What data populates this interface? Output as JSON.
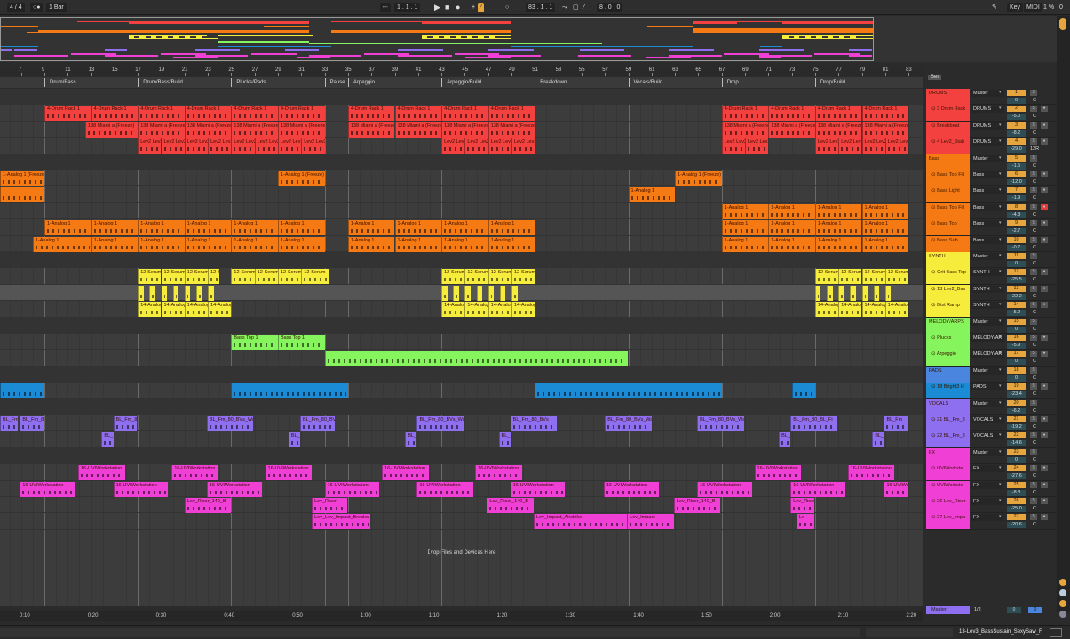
{
  "topbar": {
    "signature": "4 / 4",
    "quantize": "1 Bar",
    "position": "1 . 1 . 1",
    "loop_start": "83 . 1 . 1",
    "loop_length": "8 . 0 . 0",
    "key": "Key",
    "midi": "MIDI",
    "cpu": "1 %",
    "disk": "0"
  },
  "ruler_bars": [
    7,
    9,
    11,
    13,
    15,
    17,
    19,
    21,
    23,
    25,
    27,
    29,
    31,
    33,
    35,
    37,
    39,
    41,
    43,
    45,
    47,
    49,
    51,
    53,
    55,
    57,
    59,
    61,
    63,
    65,
    67,
    69,
    71,
    73,
    75,
    77,
    79,
    81,
    83
  ],
  "locators": [
    {
      "bar": 9,
      "label": "Drum/Bass"
    },
    {
      "bar": 17,
      "label": "Drum/Bass/Build"
    },
    {
      "bar": 25,
      "label": "Plucks/Pads"
    },
    {
      "bar": 33,
      "label": "Pause"
    },
    {
      "bar": 35,
      "label": "Arpeggio"
    },
    {
      "bar": 43,
      "label": "Arpeggio/Build"
    },
    {
      "bar": 51,
      "label": "Breakdown"
    },
    {
      "bar": 59,
      "label": "Vocals/Build"
    },
    {
      "bar": 67,
      "label": "Drop"
    },
    {
      "bar": 75,
      "label": "Drop/Build"
    }
  ],
  "time_ticks": [
    "0:10",
    "0:20",
    "0:30",
    "0:40",
    "0:50",
    "1:00",
    "1:10",
    "1:20",
    "1:30",
    "1:40",
    "1:50",
    "2:00",
    "2:10",
    "2:20"
  ],
  "drop_hint": "Drop Files and Devices Here",
  "set_label": "Set",
  "master": {
    "name": "Master",
    "route": "1/2",
    "vol": "0",
    "pan": "0"
  },
  "status_text": "13-Lev3_BassSustain_SexySaw_F",
  "colors": {
    "red": "#f2413f",
    "orange": "#f57a13",
    "yellow": "#f5ec3c",
    "green": "#86f45c",
    "blue": "#1b8bd6",
    "purple": "#8e6ff0",
    "pink": "#f03fd4",
    "headerblue": "#4a86e0"
  },
  "tracks": [
    {
      "name": "DRUMS",
      "color": "red",
      "route": "Master",
      "num": "1",
      "vol": "0",
      "pan": "C",
      "group": true,
      "clips": []
    },
    {
      "name": "3 Drum Rack",
      "color": "red",
      "route": "DRUMS",
      "num": "2",
      "vol": "-5.0",
      "pan": "C",
      "clips": [
        [
          9,
          4,
          "4-Drum Rack 1"
        ],
        [
          13,
          4,
          "4-Drum Rack 1"
        ],
        [
          17,
          4,
          "4-Drum Rack 1"
        ],
        [
          21,
          4,
          "4-Drum Rack 1"
        ],
        [
          25,
          4,
          "4-Drum Rack 1"
        ],
        [
          29,
          4,
          "4-Drum Rack 1"
        ],
        [
          35,
          4,
          "4-Drum Rack 1"
        ],
        [
          39,
          4,
          "4-Drum Rack 1"
        ],
        [
          43,
          4,
          "4-Drum Rack 1"
        ],
        [
          47,
          4,
          "4-Drum Rack 1"
        ],
        [
          67,
          4,
          "4-Drum Rack 1"
        ],
        [
          71,
          4,
          "4-Drum Rack 1"
        ],
        [
          75,
          4,
          "4-Drum Rack 1"
        ],
        [
          79,
          4,
          "4-Drum Rack 1"
        ]
      ]
    },
    {
      "name": "Breakbeat",
      "color": "red",
      "route": "DRUMS",
      "num": "3",
      "vol": "-8.2",
      "pan": "C",
      "clips": [
        [
          12.5,
          4.5,
          "138 Miami a (Freeze)"
        ],
        [
          17,
          4,
          "138 Miami a (Freeze)"
        ],
        [
          21,
          4,
          "138 Miami a (Freeze)"
        ],
        [
          25,
          4,
          "138 Miami a (Freeze)"
        ],
        [
          29,
          4,
          "138 Miami a (Freeze)"
        ],
        [
          35,
          4,
          "138 Miami a (Freeze)"
        ],
        [
          39,
          4,
          "138 Miami a (Freeze)"
        ],
        [
          43,
          4,
          "138 Miami a (Freeze)"
        ],
        [
          47,
          4,
          "138 Miami a (Freeze)"
        ],
        [
          67,
          4,
          "138 Miami a (Freeze)"
        ],
        [
          71,
          4,
          "138 Miami a (Freeze)"
        ],
        [
          75,
          4,
          "138 Miami a (Freeze)"
        ],
        [
          79,
          4,
          "138 Miami a (Freeze)"
        ]
      ]
    },
    {
      "name": "4 Lev2_Stab",
      "color": "red",
      "route": "DRUMS",
      "num": "4",
      "vol": "-29.0",
      "pan": "12R",
      "clips": [
        [
          17,
          2,
          "Lev2 Lev2"
        ],
        [
          19,
          2,
          "Lev2 Lev2"
        ],
        [
          21,
          2,
          "Lev2 Lev2"
        ],
        [
          23,
          2,
          "Lev2 Lev2"
        ],
        [
          25,
          2,
          "Lev2 Lev2"
        ],
        [
          27,
          2,
          "Lev2 Lev2"
        ],
        [
          29,
          2,
          "Lev2 Lev2"
        ],
        [
          31,
          2,
          "Lev2 Lev2"
        ],
        [
          43,
          2,
          "Lev2 Lev2"
        ],
        [
          45,
          2,
          "Lev2 Lev2"
        ],
        [
          47,
          2,
          "Lev2 Lev2"
        ],
        [
          49,
          2,
          "Lev2 Lev2"
        ],
        [
          67,
          2,
          "Lev2 Lev2"
        ],
        [
          69,
          2,
          "Lev2 Lev2"
        ],
        [
          75,
          2,
          "Lev2 Lev2"
        ],
        [
          77,
          2,
          "Lev2 Lev2"
        ],
        [
          79,
          2,
          "Lev2 Lev2"
        ],
        [
          81,
          2,
          "Lev2 Lev2"
        ]
      ]
    },
    {
      "name": "Bass",
      "color": "orange",
      "route": "Master",
      "num": "5",
      "vol": "-1.5",
      "pan": "C",
      "group": true,
      "clips": []
    },
    {
      "name": "Bass Top Fill",
      "color": "orange",
      "route": "Bass",
      "num": "6",
      "vol": "-12.0",
      "pan": "C",
      "clips": [
        [
          5.2,
          3.8,
          "1-Analog 1 (Freeze)"
        ],
        [
          29,
          4,
          "1-Analog 1 (Freeze)"
        ],
        [
          63,
          4,
          "1-Analog 1 (Freeze)"
        ]
      ]
    },
    {
      "name": "Bass Light",
      "color": "orange",
      "route": "Bass",
      "num": "7",
      "vol": "-1.9",
      "pan": "C",
      "clips": [
        [
          5.2,
          3.8,
          ""
        ],
        [
          59,
          4,
          "1-Analog 1"
        ]
      ]
    },
    {
      "name": "Bass Top Fill",
      "color": "orange",
      "route": "Bass",
      "num": "8",
      "vol": "-4.8",
      "pan": "C",
      "armed": true,
      "clips": [
        [
          67,
          4,
          "1-Analog 1"
        ],
        [
          71,
          4,
          "1-Analog 1"
        ],
        [
          75,
          4,
          "1-Analog 1"
        ],
        [
          79,
          4,
          "1-Analog 1"
        ]
      ]
    },
    {
      "name": "Bass Top",
      "color": "orange",
      "route": "Bass",
      "num": "9",
      "vol": "-2.7",
      "pan": "C",
      "clips": [
        [
          9,
          4,
          "1-Analog 1"
        ],
        [
          13,
          4,
          "1-Analog 1"
        ],
        [
          17,
          4,
          "1-Analog 1"
        ],
        [
          21,
          4,
          "1-Analog 1"
        ],
        [
          25,
          4,
          "1-Analog 1"
        ],
        [
          29,
          4,
          "1-Analog 1"
        ],
        [
          35,
          4,
          "1-Analog 1"
        ],
        [
          39,
          4,
          "1-Analog 1"
        ],
        [
          43,
          4,
          "1-Analog 1"
        ],
        [
          47,
          4,
          "1-Analog 1"
        ],
        [
          67,
          4,
          "1-Analog 1"
        ],
        [
          71,
          4,
          "1-Analog 1"
        ],
        [
          75,
          4,
          "1-Analog 1"
        ],
        [
          79,
          4,
          "1-Analog 1"
        ]
      ]
    },
    {
      "name": "Bass Sub",
      "color": "orange",
      "route": "Bass",
      "num": "10",
      "vol": "-0.7",
      "pan": "C",
      "clips": [
        [
          8,
          5,
          "1-Analog 1"
        ],
        [
          13,
          4,
          "1-Analog 1"
        ],
        [
          17,
          4,
          "1-Analog 1"
        ],
        [
          21,
          4,
          "1-Analog 1"
        ],
        [
          25,
          4,
          "1-Analog 1"
        ],
        [
          29,
          4,
          "1-Analog 1"
        ],
        [
          35,
          4,
          "1-Analog 1"
        ],
        [
          39,
          4,
          "1-Analog 1"
        ],
        [
          43,
          4,
          "1-Analog 1"
        ],
        [
          47,
          4,
          "1-Analog 1"
        ],
        [
          67,
          4,
          "1-Analog 1"
        ],
        [
          71,
          4,
          "1-Analog 1"
        ],
        [
          75,
          4,
          "1-Analog 1"
        ],
        [
          79,
          4,
          "1-Analog 1"
        ]
      ]
    },
    {
      "name": "SYNTH",
      "color": "yellow",
      "route": "Master",
      "num": "11",
      "vol": "0",
      "pan": "C",
      "group": true,
      "clips": []
    },
    {
      "name": "Grit Bass Top",
      "color": "yellow",
      "route": "SYNTH",
      "num": "12",
      "vol": "-25.5",
      "pan": "C",
      "clips": [
        [
          17,
          2,
          "12-Serum"
        ],
        [
          19,
          2,
          "12-Serum"
        ],
        [
          21,
          2,
          "12-Serum"
        ],
        [
          23,
          1,
          "12-S"
        ],
        [
          25,
          2,
          "12-Serum"
        ],
        [
          27,
          2,
          "12-Serum"
        ],
        [
          29,
          2,
          "12-Serum"
        ],
        [
          31,
          2.3,
          "12-Serum"
        ],
        [
          43,
          2,
          "12-Serum"
        ],
        [
          45,
          2,
          "12-Serum"
        ],
        [
          47,
          2,
          "12-Serum"
        ],
        [
          49,
          2,
          "12-Serum"
        ],
        [
          75,
          2,
          "12-Serum"
        ],
        [
          77,
          2,
          "12-Serum"
        ],
        [
          79,
          2,
          "12-Serum"
        ],
        [
          81,
          2,
          "12-Serum"
        ]
      ]
    },
    {
      "name": "13 Lev2_Bas",
      "color": "yellow",
      "route": "SYNTH",
      "num": "13",
      "vol": "-22.2",
      "pan": "C",
      "selected": true,
      "clips": [
        [
          17,
          0.5,
          ""
        ],
        [
          18,
          0.5,
          ""
        ],
        [
          19,
          0.5,
          ""
        ],
        [
          20,
          0.5,
          ""
        ],
        [
          21,
          0.5,
          ""
        ],
        [
          22,
          0.5,
          ""
        ],
        [
          23,
          0.5,
          ""
        ],
        [
          43,
          0.5,
          ""
        ],
        [
          44,
          0.5,
          ""
        ],
        [
          45,
          0.5,
          ""
        ],
        [
          46,
          0.5,
          ""
        ],
        [
          47,
          0.5,
          ""
        ],
        [
          48,
          0.5,
          ""
        ],
        [
          49,
          0.5,
          ""
        ],
        [
          75,
          0.5,
          ""
        ],
        [
          76,
          0.5,
          ""
        ],
        [
          77,
          0.5,
          ""
        ],
        [
          78,
          0.5,
          ""
        ],
        [
          79,
          0.5,
          ""
        ],
        [
          80,
          0.5,
          ""
        ],
        [
          81,
          0.5,
          ""
        ]
      ]
    },
    {
      "name": "Dist Ramp",
      "color": "yellow",
      "route": "SYNTH",
      "num": "14",
      "vol": "-5.2",
      "pan": "C",
      "clips": [
        [
          17,
          2,
          "14-Analog"
        ],
        [
          19,
          2,
          "14-Analog"
        ],
        [
          21,
          2,
          "14-Analog"
        ],
        [
          23,
          2,
          "14-Analog"
        ],
        [
          43,
          2,
          "14-Analog"
        ],
        [
          45,
          2,
          "14-Analog"
        ],
        [
          47,
          2,
          "14-Analog"
        ],
        [
          49,
          2,
          "14-Analog"
        ],
        [
          75,
          2,
          "14-Analog"
        ],
        [
          77,
          2,
          "14-Analog"
        ],
        [
          79,
          2,
          "14-Analog"
        ],
        [
          81,
          2,
          "14-Analog"
        ]
      ]
    },
    {
      "name": "MELODY/ARPS",
      "color": "green",
      "route": "Master",
      "num": "15",
      "vol": "0",
      "pan": "C",
      "group": true,
      "clips": []
    },
    {
      "name": "Plucks",
      "color": "green",
      "route": "MELODY/AR",
      "num": "16",
      "vol": "-5.9",
      "pan": "C",
      "clips": [
        [
          25,
          4,
          "Bass Top 1"
        ],
        [
          29,
          4,
          "Bass Top 1"
        ]
      ]
    },
    {
      "name": "Arpeggio",
      "color": "green",
      "route": "MELODY/AR",
      "num": "17",
      "vol": "0",
      "pan": "C",
      "clips": [
        [
          33,
          26,
          ""
        ]
      ]
    },
    {
      "name": "PADS",
      "color": "headerblue",
      "route": "Master",
      "num": "18",
      "vol": "0",
      "pan": "C",
      "group": true,
      "clips": []
    },
    {
      "name": "18 Bright3 H",
      "color": "blue",
      "route": "PADS",
      "num": "19",
      "vol": "-23.4",
      "pan": "C",
      "clips": [
        [
          5.2,
          3.8,
          ""
        ],
        [
          25,
          10,
          ""
        ],
        [
          51,
          16,
          ""
        ],
        [
          73,
          2,
          ""
        ]
      ]
    },
    {
      "name": "VOCALS",
      "color": "purple",
      "route": "Master",
      "num": "20",
      "vol": "-6.2",
      "pan": "C",
      "group": true,
      "clips": []
    },
    {
      "name": "21 BL_Fm_8",
      "color": "purple",
      "route": "VOCALS",
      "num": "21",
      "vol": "-19.2",
      "pan": "C",
      "clips": [
        [
          5.2,
          1.5,
          "BL_Fm"
        ],
        [
          6.9,
          2,
          "BL_Fm_80_BVs_Wave"
        ],
        [
          14.9,
          2,
          "BL_Fm_80_BVs"
        ],
        [
          22.9,
          4,
          "BL_Fm_80_BVs_Wave"
        ],
        [
          30.9,
          3,
          "BL_Fm_80_BVs"
        ],
        [
          40.9,
          4,
          "BL_Fm_80_BVs_Wave"
        ],
        [
          48.9,
          4,
          "BL_Fm_80_BVs"
        ],
        [
          57,
          4,
          "BL_Fm_80_BVs_Wave"
        ],
        [
          64.9,
          4,
          "BL_Fm_80_BVs_Wave"
        ],
        [
          72.9,
          4,
          "BL_Fm_80_BL_Fi"
        ],
        [
          80.9,
          2,
          "BL_Fm"
        ]
      ]
    },
    {
      "name": "22 BL_Fm_8",
      "color": "purple",
      "route": "VOCALS",
      "num": "22",
      "vol": "-14.6",
      "pan": "C",
      "clips": [
        [
          13.9,
          1,
          "BL_"
        ],
        [
          29.9,
          1,
          "BL_"
        ],
        [
          39.9,
          1,
          "BL_"
        ],
        [
          47.9,
          1,
          "BL_"
        ],
        [
          71.9,
          1,
          "BL_"
        ],
        [
          79.9,
          1,
          "BL_"
        ]
      ]
    },
    {
      "name": "FX",
      "color": "pink",
      "route": "Master",
      "num": "23",
      "vol": "0",
      "pan": "C",
      "group": true,
      "clips": []
    },
    {
      "name": "UVIWorkste",
      "color": "pink",
      "route": "FX",
      "num": "24",
      "vol": "-27.6",
      "pan": "C",
      "clips": [
        [
          11.9,
          4,
          "16-UVIWorkstation"
        ],
        [
          19.9,
          4,
          "16-UVIWorkstation"
        ],
        [
          27.9,
          4,
          "16-UVIWorkstation"
        ],
        [
          37.9,
          4,
          "16-UVIWorkstation"
        ],
        [
          45.9,
          4,
          "16-UVIWorkstation"
        ],
        [
          69.8,
          4,
          "16-UVIWorkstation"
        ],
        [
          77.8,
          4,
          "16-UVIWorkstation"
        ]
      ]
    },
    {
      "name": "UVIWorkste",
      "color": "pink",
      "route": "FX",
      "num": "25",
      "vol": "-8.8",
      "pan": "C",
      "clips": [
        [
          6.9,
          4.8,
          "16-UVIWorkstation"
        ],
        [
          14.9,
          4.7,
          "16-UVIWorkstation"
        ],
        [
          22.9,
          4.7,
          "16-UVIWorkstation"
        ],
        [
          33,
          4.7,
          "16-UVIWorkstation"
        ],
        [
          40.9,
          4.8,
          "16-UVIWorkstation"
        ],
        [
          48.9,
          4.7,
          "16-UVIWorkstation"
        ],
        [
          56.9,
          4.7,
          "16-UVIWorkstation"
        ],
        [
          64.9,
          4.7,
          "16-UVIWorkstation"
        ],
        [
          72.9,
          4.7,
          "16-UVIWorkstation"
        ],
        [
          80.9,
          2,
          "16-UVIWorkstation"
        ]
      ]
    },
    {
      "name": "26 Lev_Riser",
      "color": "pink",
      "route": "FX",
      "num": "26",
      "vol": "-25.0",
      "pan": "C",
      "clips": [
        [
          21,
          4,
          "Lev_Riser_140_B"
        ],
        [
          31.9,
          3,
          "Lev_Riser"
        ],
        [
          46.9,
          4,
          "Lev_Riser_140_B"
        ],
        [
          62.9,
          4,
          "Lev_Riser_140_B"
        ],
        [
          72.9,
          2,
          "Lev_Riser"
        ]
      ]
    },
    {
      "name": "27 Lev_Impa",
      "color": "pink",
      "route": "FX",
      "num": "27",
      "vol": "-20.6",
      "pan": "C",
      "clips": [
        [
          31.9,
          5,
          "Lev_Lev_Impact_Breakw"
        ],
        [
          50.9,
          8,
          "Lev_Impact_Airstrike"
        ],
        [
          58.9,
          4,
          "Lev_Impact"
        ],
        [
          73.4,
          1.5,
          "Le"
        ]
      ]
    }
  ]
}
